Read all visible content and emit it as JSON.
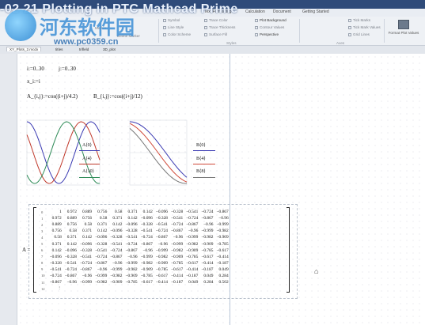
{
  "watermark": {
    "title": "-02 21 Plotting in PTC Mathcad Prime",
    "brand": "河东软件园",
    "url": "www.pc0359.cn"
  },
  "ribbon": {
    "tabs": [
      "Text Formatting",
      "Calculation",
      "Document",
      "Getting Started"
    ],
    "group1": [
      "Symbol",
      "Line Style",
      "Color Scheme"
    ],
    "group2": [
      "Trace Color",
      "Trace Thickness",
      "Surface Fill"
    ],
    "group3": [
      "Plot Background",
      "Contour Values",
      "Perspective"
    ],
    "group4": [
      "Tick Marks",
      "Tick Mark Values",
      "Grid Lines"
    ],
    "group_titles": [
      "Styles",
      "Axes"
    ],
    "format_plot_values": "Format Plot Values",
    "delete_marker": "Delete Marker",
    "marker": "Marker"
  },
  "doc_tabs": [
    "XY_Plots_2.mcdx",
    "titles",
    "trifleld",
    "3D_plot"
  ],
  "math": {
    "range_i": "i:=0..30",
    "range_j": "j:=0..30",
    "x_def": "x_i:=i",
    "A_def": "A_{i,j}:=cos((i+j)/4.2)",
    "B_def": "B_{i,j}:=cos((i+j)/12)",
    "A_label": "A =",
    "legend_a": [
      "A⟨0⟩",
      "A⟨4⟩",
      "A⟨10⟩"
    ],
    "legend_b": [
      "B⟨0⟩",
      "B⟨4⟩",
      "B⟨8⟩"
    ]
  },
  "matrix": {
    "col_header": [
      "0",
      "1",
      "2",
      "3",
      "4",
      "5",
      "6",
      "7",
      "8",
      "9",
      "10",
      "11",
      "12"
    ],
    "row_index": [
      "0",
      "1",
      "2",
      "3",
      "4",
      "5",
      "6",
      "7",
      "8",
      "9",
      "10",
      "11",
      "12"
    ],
    "rows": [
      [
        "1",
        "0.972",
        "0.889",
        "0.756",
        "0.58",
        "0.371",
        "0.142",
        "−0.096",
        "−0.328",
        "−0.541",
        "−0.724",
        "−0.867"
      ],
      [
        "0.972",
        "0.889",
        "0.756",
        "0.58",
        "0.371",
        "0.142",
        "−0.096",
        "−0.328",
        "−0.541",
        "−0.724",
        "−0.867",
        "−0.96"
      ],
      [
        "0.889",
        "0.756",
        "0.58",
        "0.371",
        "0.142",
        "−0.096",
        "−0.328",
        "−0.541",
        "−0.724",
        "−0.867",
        "−0.96",
        "−0.999"
      ],
      [
        "0.756",
        "0.58",
        "0.371",
        "0.142",
        "−0.096",
        "−0.328",
        "−0.541",
        "−0.724",
        "−0.867",
        "−0.96",
        "−0.999",
        "−0.982"
      ],
      [
        "0.58",
        "0.371",
        "0.142",
        "−0.096",
        "−0.328",
        "−0.541",
        "−0.724",
        "−0.867",
        "−0.96",
        "−0.999",
        "−0.982",
        "−0.909"
      ],
      [
        "0.371",
        "0.142",
        "−0.096",
        "−0.328",
        "−0.541",
        "−0.724",
        "−0.867",
        "−0.96",
        "−0.999",
        "−0.982",
        "−0.909",
        "−0.785"
      ],
      [
        "0.142",
        "−0.096",
        "−0.328",
        "−0.541",
        "−0.724",
        "−0.867",
        "−0.96",
        "−0.999",
        "−0.982",
        "−0.909",
        "−0.785",
        "−0.617"
      ],
      [
        "−0.096",
        "−0.328",
        "−0.541",
        "−0.724",
        "−0.867",
        "−0.96",
        "−0.999",
        "−0.982",
        "−0.909",
        "−0.785",
        "−0.617",
        "−0.414"
      ],
      [
        "−0.328",
        "−0.541",
        "−0.724",
        "−0.867",
        "−0.96",
        "−0.999",
        "−0.982",
        "−0.909",
        "−0.785",
        "−0.617",
        "−0.414",
        "−0.187"
      ],
      [
        "−0.541",
        "−0.724",
        "−0.867",
        "−0.96",
        "−0.999",
        "−0.982",
        "−0.909",
        "−0.785",
        "−0.617",
        "−0.414",
        "−0.187",
        "0.049"
      ],
      [
        "−0.724",
        "−0.867",
        "−0.96",
        "−0.999",
        "−0.982",
        "−0.909",
        "−0.785",
        "−0.617",
        "−0.414",
        "−0.187",
        "0.049",
        "0.284"
      ],
      [
        "−0.867",
        "−0.96",
        "−0.999",
        "−0.982",
        "−0.909",
        "−0.785",
        "−0.617",
        "−0.414",
        "−0.187",
        "0.049",
        "0.284",
        "0.502"
      ],
      [
        "⋮",
        "",
        "",
        "",
        "",
        "",
        "",
        "",
        "",
        "",
        "",
        ""
      ]
    ]
  },
  "plot_a": {
    "divisor": 4.2,
    "offsets": [
      0,
      4,
      10
    ],
    "colors": [
      "#3b3bb3",
      "#c0392b",
      "#2e8b57"
    ]
  },
  "plot_b": {
    "divisor": 12,
    "offsets": [
      0,
      4,
      8
    ],
    "colors": [
      "#3b3bb3",
      "#d14a3a",
      "#777777"
    ]
  }
}
